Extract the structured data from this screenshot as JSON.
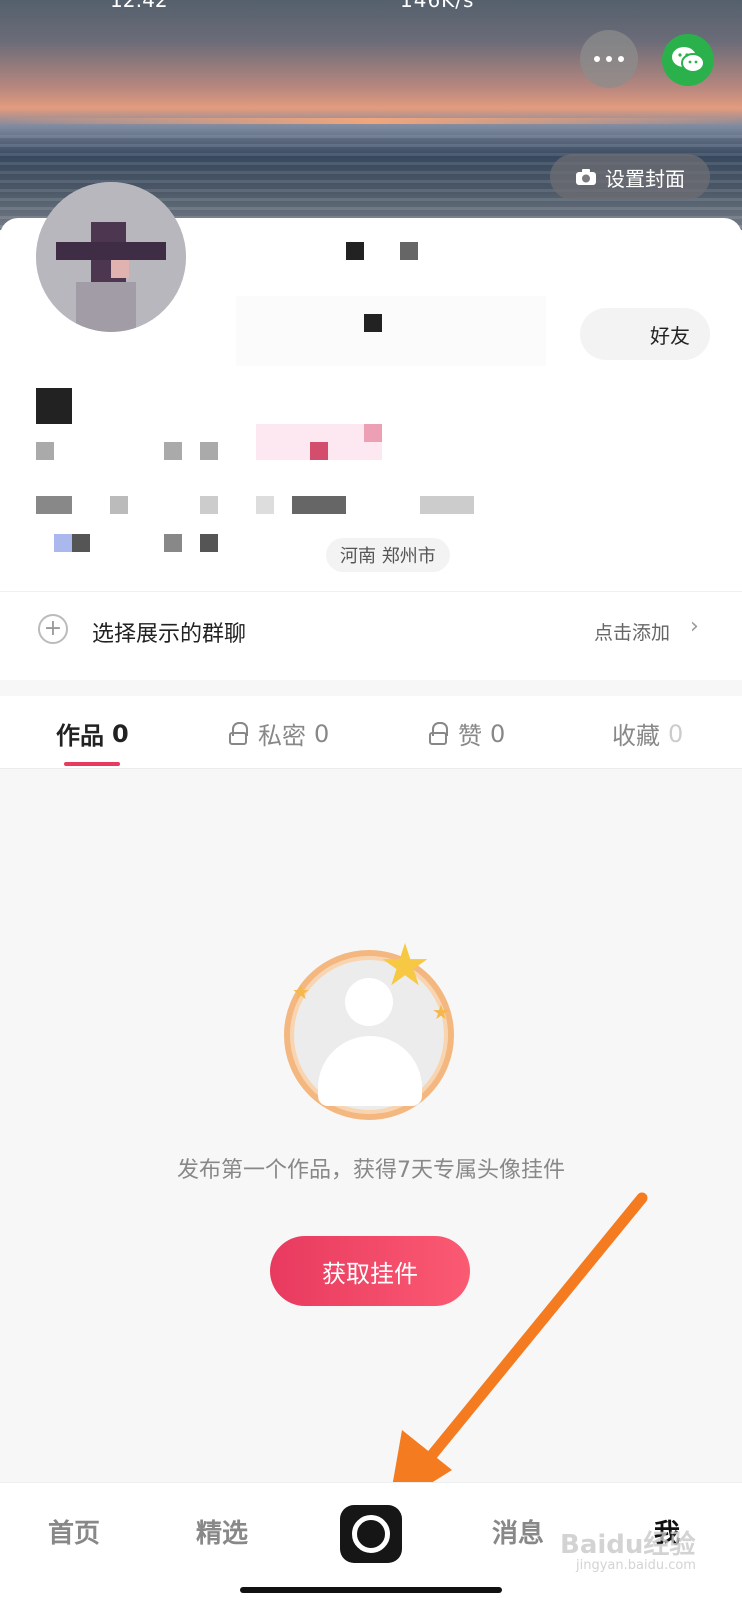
{
  "status": {
    "time": "12:42",
    "right": "146K/s"
  },
  "cover": {
    "set_cover_label": "设置封面"
  },
  "profile": {
    "friend_button": "好友",
    "location": "河南 郑州市"
  },
  "group": {
    "label": "选择展示的群聊",
    "add": "点击添加"
  },
  "tabs": [
    {
      "label": "作品",
      "count": "0"
    },
    {
      "label": "私密",
      "count": "0"
    },
    {
      "label": "赞",
      "count": "0"
    },
    {
      "label": "收藏",
      "count": "0"
    }
  ],
  "empty_state": {
    "text": "发布第一个作品，获得7天专属头像挂件",
    "button": "获取挂件"
  },
  "bottom_nav": [
    {
      "label": "首页"
    },
    {
      "label": "精选"
    },
    {
      "label": "消息"
    },
    {
      "label": "我"
    }
  ],
  "watermark": {
    "brand": "Baidu经验",
    "url": "jingyan.baidu.com"
  },
  "colors": {
    "accent": "#e83a5f",
    "wechat": "#2ab14c",
    "arrow": "#f47b20"
  },
  "icons": [
    "more-icon",
    "wechat-icon",
    "camera-icon",
    "plus-icon",
    "chevron-right-icon",
    "lock-icon",
    "shoot-icon"
  ]
}
